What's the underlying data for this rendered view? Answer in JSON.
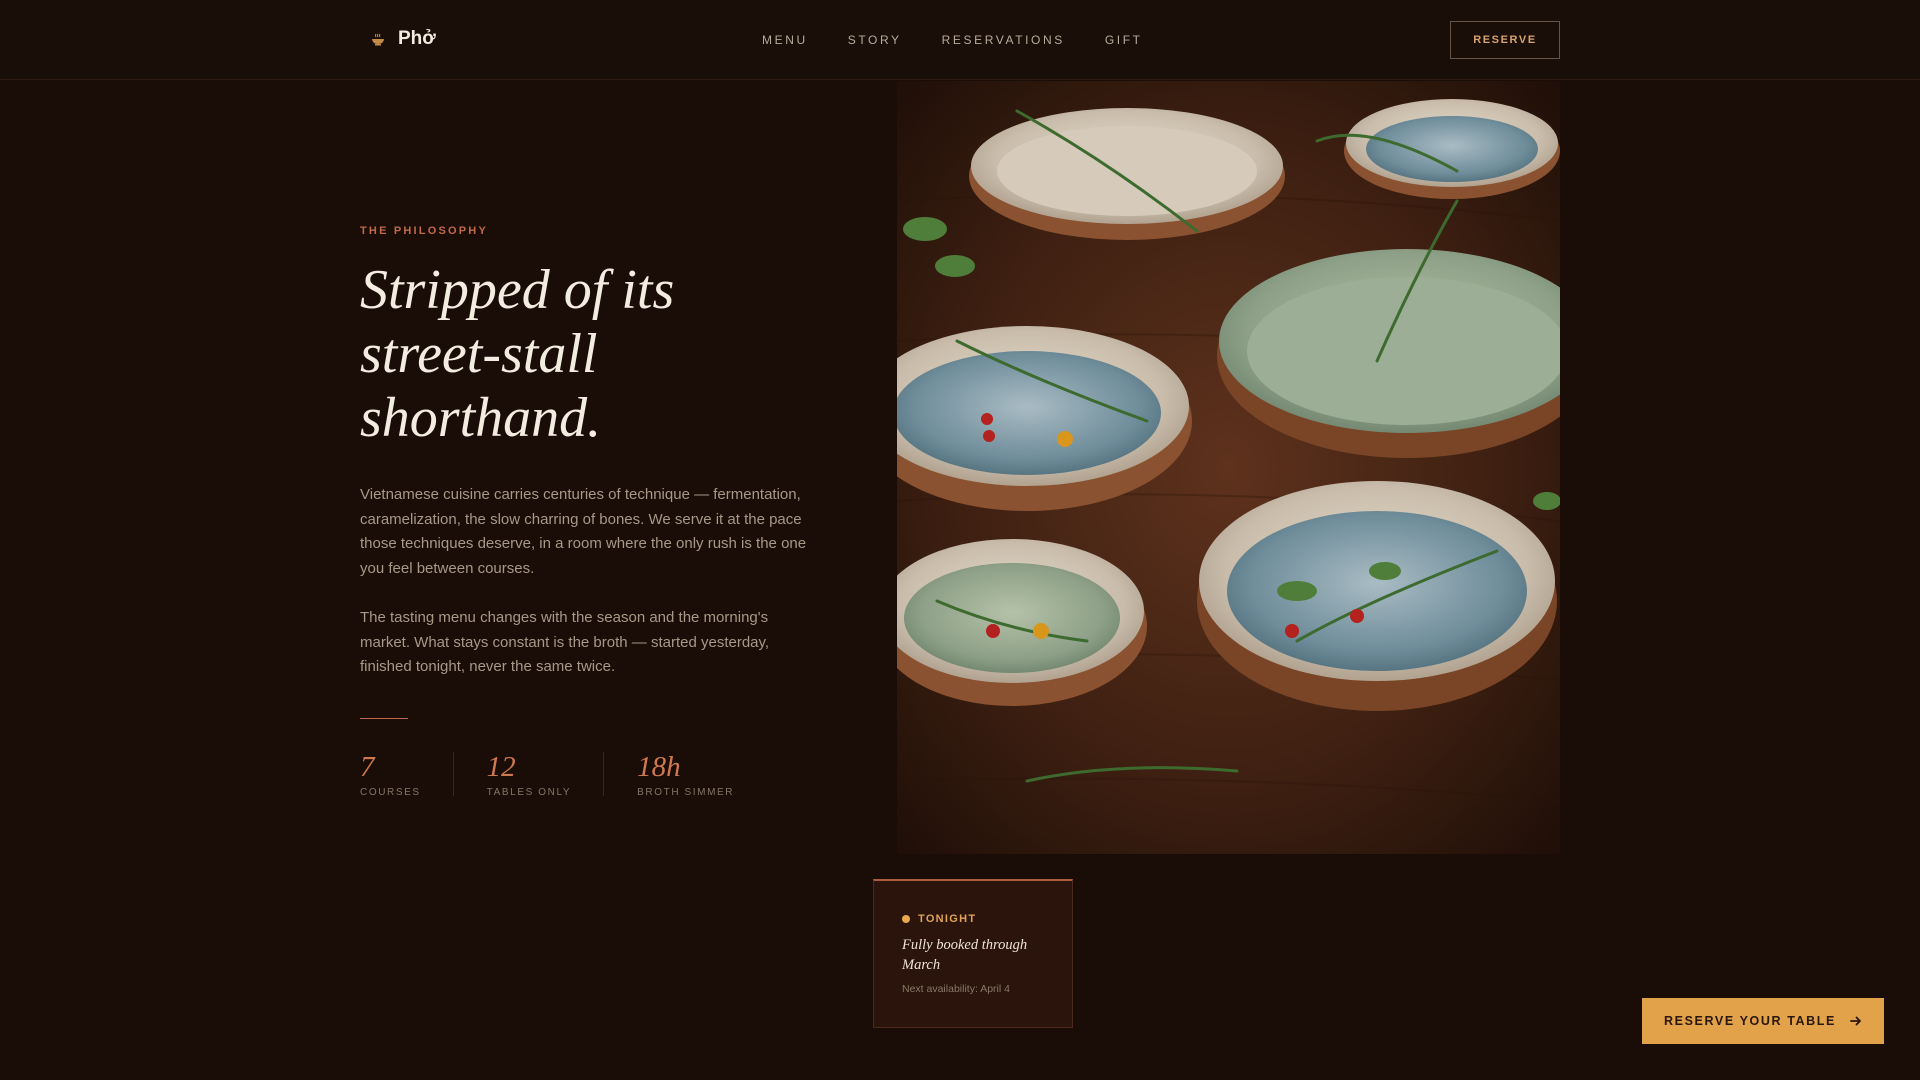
{
  "nav": {
    "brand_name": "Phở",
    "brand_icon": "bowl-icon",
    "links": [
      "MENU",
      "STORY",
      "RESERVATIONS",
      "GIFT"
    ],
    "reserve_label": "RESERVE"
  },
  "intro": {
    "eyebrow": "THE PHILOSOPHY",
    "headline": "Stripped of its street-stall shorthand.",
    "paragraph1": "Vietnamese cuisine carries centuries of technique — fermentation, caramelization, the slow charring of bones. We serve it at the pace those techniques deserve, in a room where the only rush is the one you feel between courses.",
    "paragraph2": "The tasting menu changes with the season and the morning's market. What stays constant is the broth — started yesterday, finished tonight, never the same twice."
  },
  "stats": [
    {
      "value": "7",
      "label": "COURSES"
    },
    {
      "value": "12",
      "label": "TABLES ONLY"
    },
    {
      "value": "18h",
      "label": "BROTH SIMMER"
    }
  ],
  "tonight": {
    "tag": "TONIGHT",
    "title": "Fully booked through March",
    "subtitle": "Next availability: April 4"
  },
  "cta": {
    "label": "RESERVE YOUR TABLE",
    "icon": "arrow-right-icon"
  },
  "colors": {
    "background": "#1a0d07",
    "accent": "#c0694a",
    "gold": "#e2a24a"
  }
}
